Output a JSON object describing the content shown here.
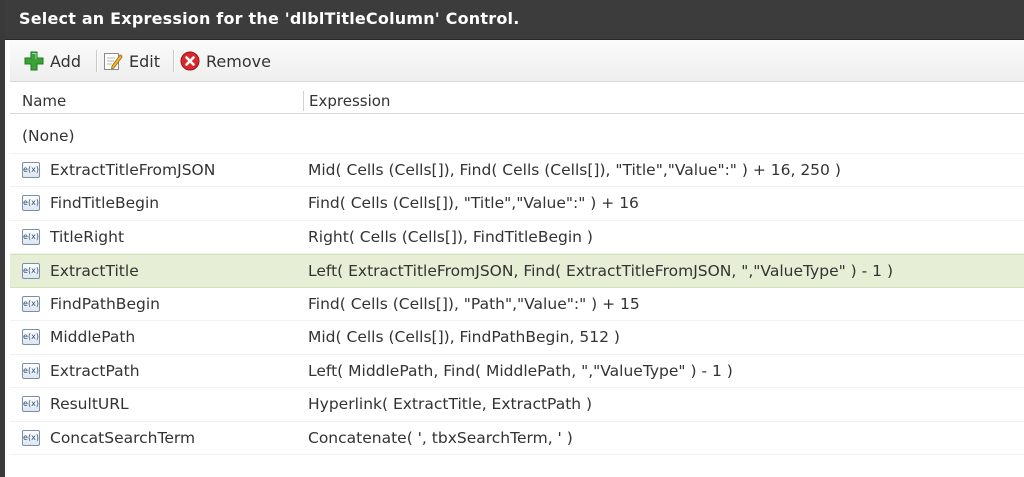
{
  "dialog": {
    "title": "Select an Expression for the 'dlblTitleColumn' Control."
  },
  "toolbar": {
    "add_label": "Add",
    "edit_label": "Edit",
    "remove_label": "Remove"
  },
  "grid": {
    "columns": {
      "name": "Name",
      "expression": "Expression"
    },
    "fx_icon_text": "e(x)",
    "rows": [
      {
        "name": "(None)",
        "expression": ""
      },
      {
        "name": "ExtractTitleFromJSON",
        "expression": "Mid( Cells (Cells[]), Find( Cells (Cells[]), \"Title\",\"Value\":\" ) + 16, 250 )"
      },
      {
        "name": "FindTitleBegin",
        "expression": "Find( Cells (Cells[]), \"Title\",\"Value\":\" ) + 16"
      },
      {
        "name": "TitleRight",
        "expression": "Right( Cells (Cells[]), FindTitleBegin )"
      },
      {
        "name": "ExtractTitle",
        "expression": "Left( ExtractTitleFromJSON, Find( ExtractTitleFromJSON, \",\"ValueType\" ) - 1 )"
      },
      {
        "name": "FindPathBegin",
        "expression": "Find( Cells (Cells[]), \"Path\",\"Value\":\" ) + 15"
      },
      {
        "name": "MiddlePath",
        "expression": "Mid( Cells (Cells[]), FindPathBegin, 512 )"
      },
      {
        "name": "ExtractPath",
        "expression": "Left( MiddlePath, Find( MiddlePath, \",\"ValueType\" ) - 1 )"
      },
      {
        "name": "ResultURL",
        "expression": "Hyperlink( ExtractTitle, ExtractPath )"
      },
      {
        "name": "ConcatSearchTerm",
        "expression": "Concatenate( ', tbxSearchTerm, ' )"
      }
    ]
  },
  "colors": {
    "titlebar_bg": "#3c3c3c",
    "selected_row_bg": "#e6efd6",
    "add_icon": "#3aa335",
    "remove_icon": "#d8282c"
  },
  "icons": {
    "add": "plus-icon",
    "edit": "edit-pencil-icon",
    "remove": "remove-x-icon",
    "expression": "expression-fx-icon"
  }
}
